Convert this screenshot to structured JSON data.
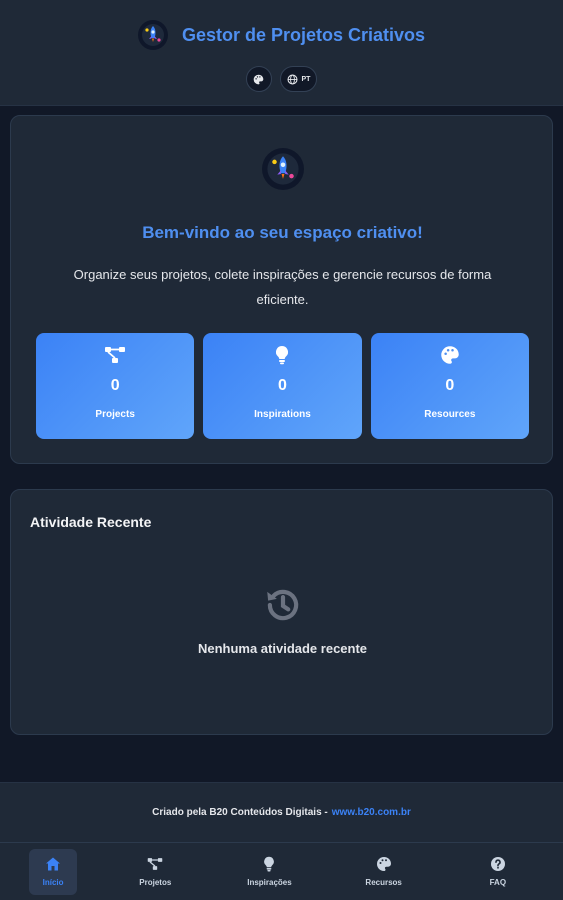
{
  "header": {
    "title": "Gestor de Projetos Criativos",
    "theme_button_icon": "palette-icon",
    "language_button": {
      "icon": "globe-icon",
      "label": "PT"
    }
  },
  "welcome": {
    "title": "Bem-vindo ao seu espaço criativo!",
    "text": "Organize seus projetos, colete inspirações e gerencie recursos de forma eficiente.",
    "stats": [
      {
        "icon": "project-diagram-icon",
        "value": "0",
        "label": "Projects"
      },
      {
        "icon": "lightbulb-icon",
        "value": "0",
        "label": "Inspirations"
      },
      {
        "icon": "palette-icon",
        "value": "0",
        "label": "Resources"
      }
    ]
  },
  "activity": {
    "title": "Atividade Recente",
    "empty_text": "Nenhuma atividade recente"
  },
  "footer": {
    "text": "Criado pela B20 Conteúdos Digitais -",
    "link": "www.b20.com.br"
  },
  "nav": [
    {
      "label": "Início",
      "icon": "home-icon",
      "active": true
    },
    {
      "label": "Projetos",
      "icon": "project-diagram-icon",
      "active": false
    },
    {
      "label": "Inspirações",
      "icon": "lightbulb-icon",
      "active": false
    },
    {
      "label": "Recursos",
      "icon": "palette-icon",
      "active": false
    },
    {
      "label": "FAQ",
      "icon": "question-circle-icon",
      "active": false
    }
  ],
  "colors": {
    "accent": "#3b82f6",
    "background": "#111827",
    "surface": "#1f2937"
  }
}
